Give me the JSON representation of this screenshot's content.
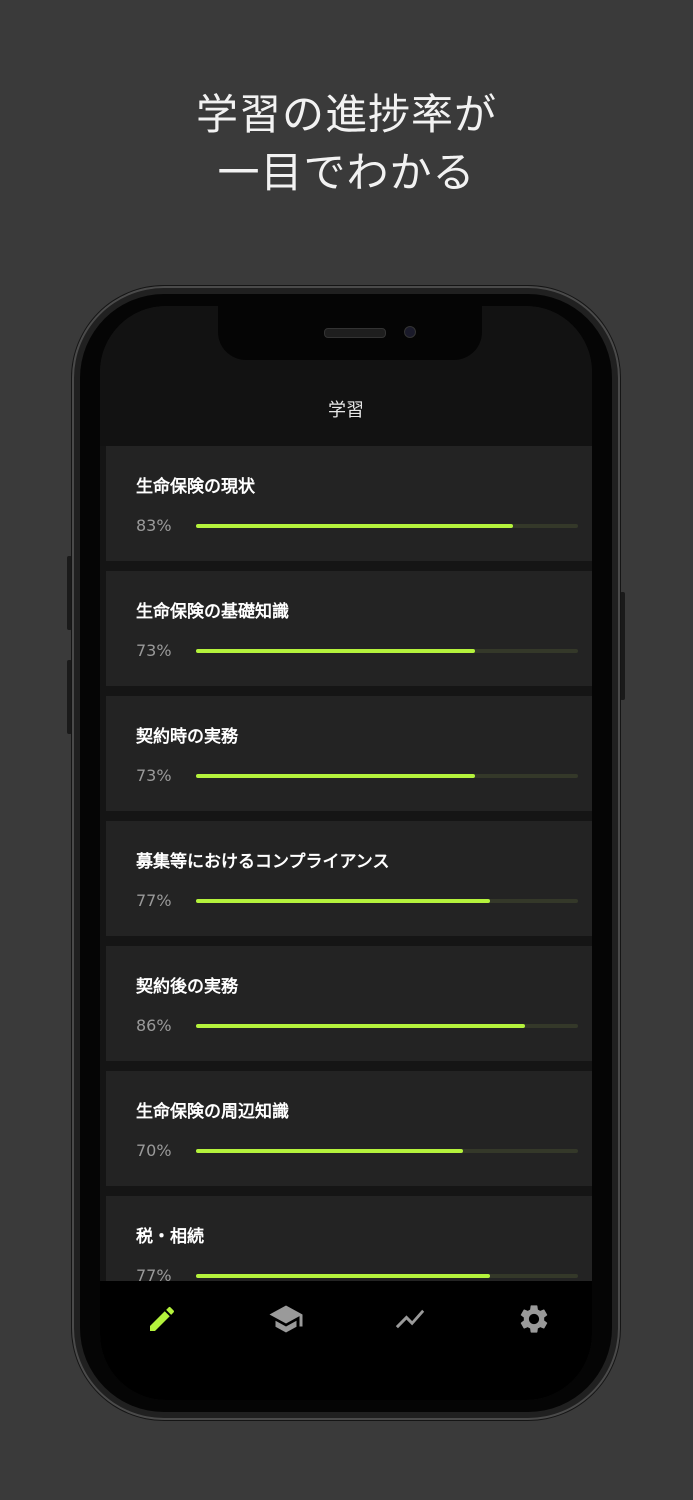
{
  "headline": {
    "line1": "学習の進捗率が",
    "line2": "一目でわかる"
  },
  "app": {
    "title": "学習"
  },
  "items": [
    {
      "title": "生命保険の現状",
      "percent_label": "83%",
      "progress": 0.83
    },
    {
      "title": "生命保険の基礎知識",
      "percent_label": "73%",
      "progress": 0.73
    },
    {
      "title": "契約時の実務",
      "percent_label": "73%",
      "progress": 0.73
    },
    {
      "title": "募集等におけるコンプライアンス",
      "percent_label": "77%",
      "progress": 0.77
    },
    {
      "title": "契約後の実務",
      "percent_label": "86%",
      "progress": 0.86
    },
    {
      "title": "生命保険の周辺知識",
      "percent_label": "70%",
      "progress": 0.7
    },
    {
      "title": "税・相続",
      "percent_label": "77%",
      "progress": 0.77
    }
  ],
  "tabs": [
    {
      "icon": "pencil-icon",
      "active": true
    },
    {
      "icon": "graduation-cap-icon",
      "active": false
    },
    {
      "icon": "trend-chart-icon",
      "active": false
    },
    {
      "icon": "gear-icon",
      "active": false
    }
  ],
  "colors": {
    "accent": "#b4f23c",
    "inactive_icon": "#9a9a9a",
    "background": "#3a3a3a",
    "card": "#232323"
  }
}
